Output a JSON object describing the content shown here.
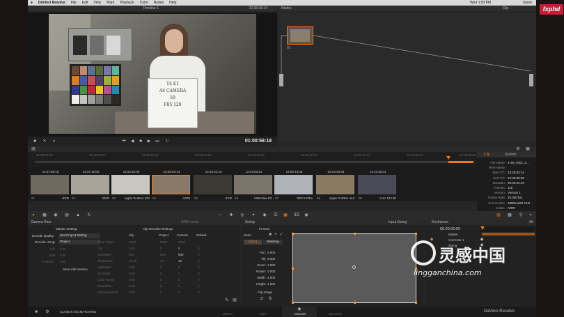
{
  "menubar": {
    "app_name": "DaVinci Resolve",
    "menus": [
      "File",
      "Edit",
      "View",
      "Mark",
      "Playback",
      "Color",
      "Nodes",
      "Help"
    ],
    "clock": "Wed 1:53 PM",
    "user": "future"
  },
  "viewer": {
    "timeline_name": "Timeline 1",
    "timecode_top": "23:35:03:14",
    "timecode": "01:00:56:19",
    "sign_text": [
      "T4 E1",
      "A4 CAMERA",
      "50",
      "F85 120"
    ]
  },
  "nodes": {
    "title": "Nodes",
    "clip_label": "Clip",
    "node_label": "01"
  },
  "timeline": {
    "ruler": [
      "01:00:00:00",
      "01:00:07:07",
      "01:00:14:14",
      "01:00:21:21",
      "01:00:29:03",
      "01:00:36:10",
      "01:00:43:17",
      "01:00:50:24",
      "01:00:58:08"
    ]
  },
  "clips": [
    {
      "tc": "12:37:06:15",
      "num": "01",
      "codec": "RED"
    },
    {
      "tc": "13:37:12:00",
      "num": "02",
      "codec": "DNG"
    },
    {
      "tc": "11:55:20:09",
      "num": "03",
      "codec": "Apple ProRes 422"
    },
    {
      "tc": "23:35:03:14",
      "num": "04",
      "codec": "ARRI"
    },
    {
      "tc": "10:10:31:10",
      "num": "05",
      "codec": "EXR"
    },
    {
      "tc": "12:34:03:01",
      "num": "06",
      "codec": "F55 Raw SG"
    },
    {
      "tc": "12:56:43:03",
      "num": "07",
      "codec": "RED HDRx"
    },
    {
      "tc": "02:23:43:06",
      "num": "08",
      "codec": "Apple ProRes 444"
    },
    {
      "tc": "14:12:32:01",
      "num": "09",
      "codec": "YUV 422 8b"
    }
  ],
  "clip_info": {
    "tabs": [
      "Clip",
      "System"
    ],
    "fields": [
      {
        "k": "File Name:",
        "v": "4-28_A001_0..."
      },
      {
        "k": "Reel Name:",
        "v": ""
      },
      {
        "k": "Start T/C:",
        "v": "23:35:03:14"
      },
      {
        "k": "End T/C:",
        "v": "23:35:08:08"
      },
      {
        "k": "Duration:",
        "v": "00:00:04:19"
      },
      {
        "k": "Frames:",
        "v": "119"
      },
      {
        "k": "Version:",
        "v": "Version 1"
      },
      {
        "k": "Frame Rate:",
        "v": "25.000 fps"
      },
      {
        "k": "Source Res:",
        "v": "2880x1620 16:9"
      },
      {
        "k": "Codec:",
        "v": "ARRI"
      }
    ]
  },
  "camera_raw": {
    "title": "Camera Raw",
    "master_title": "Master Settings",
    "decode_quality_label": "Decode Quality:",
    "decode_quality_value": "Use Project Setting",
    "decode_using_label": "Decode Using:",
    "decode_using_value": "Project",
    "lift_label": "Lift:",
    "lift_value": "0.00",
    "gain_label": "Gain:",
    "gain_value": "0.00",
    "contrast_label": "Contrast:",
    "contrast_value": "0.00",
    "save_version": "Save with Version",
    "clip_decoder_title": "Clip Decoder Settings",
    "arri_mode": "ARRI mode",
    "columns": [
      "Clip",
      "Project",
      "Camera",
      "Default"
    ],
    "rows": [
      {
        "name": "Color Temp:",
        "clip": "5600",
        "project": "5600",
        "camera": "5600",
        "default": ""
      },
      {
        "name": "Tint:",
        "clip": "0.00",
        "project": "0",
        "camera": "0",
        "default": "0"
      },
      {
        "name": "Exposure:",
        "clip": "800",
        "project": "800",
        "camera": "800",
        "default": "0"
      },
      {
        "name": "Sharpness:",
        "clip": "10.00",
        "project": "10",
        "camera": "10",
        "default": "0"
      },
      {
        "name": "Highlights:",
        "clip": "0.00",
        "project": "0",
        "camera": "0",
        "default": "0"
      },
      {
        "name": "Shadows:",
        "clip": "0.00",
        "project": "0",
        "camera": "0",
        "default": "0"
      },
      {
        "name": "Color Boost:",
        "clip": "0.00",
        "project": "0",
        "camera": "0",
        "default": "0"
      },
      {
        "name": "Saturation:",
        "clip": "0.00",
        "project": "0",
        "camera": "0",
        "default": "0"
      },
      {
        "name": "Midtone Detail:",
        "clip": "0.00",
        "project": "0",
        "camera": "0",
        "default": "0"
      }
    ]
  },
  "sizing": {
    "title": "Sizing",
    "input_sizing": "Input Sizing",
    "presets": "Presets",
    "none": "None",
    "tabs": [
      "Sizing",
      "Blanking"
    ],
    "fields": [
      {
        "k": "Pan:",
        "v": "0.000"
      },
      {
        "k": "Tilt:",
        "v": "0.000"
      },
      {
        "k": "Zoom:",
        "v": "1.000"
      },
      {
        "k": "Rotate:",
        "v": "0.000"
      },
      {
        "k": "Width:",
        "v": "1.000"
      },
      {
        "k": "Height:",
        "v": "1.000"
      }
    ],
    "flip_image": "Flip Image"
  },
  "keyframes": {
    "title": "Keyframes",
    "filter": "All",
    "timecode": "00:00:00:00",
    "tracks": [
      "Master",
      "Corrector 1",
      "Sizing"
    ]
  },
  "bottom": {
    "project": "CLASS 6 001 MATCHING",
    "pages": [
      "MEDIA",
      "EDIT",
      "COLOR",
      "DELIVER"
    ],
    "brand": "DaVinci Resolve"
  },
  "watermark": {
    "logo": "fxphd",
    "cn": "灵感中国",
    "url": "lingganchina.com"
  },
  "colors": {
    "accent": "#f07a1a",
    "active_page": "#e8e8e8",
    "fxphd_red": "#c0203a"
  }
}
